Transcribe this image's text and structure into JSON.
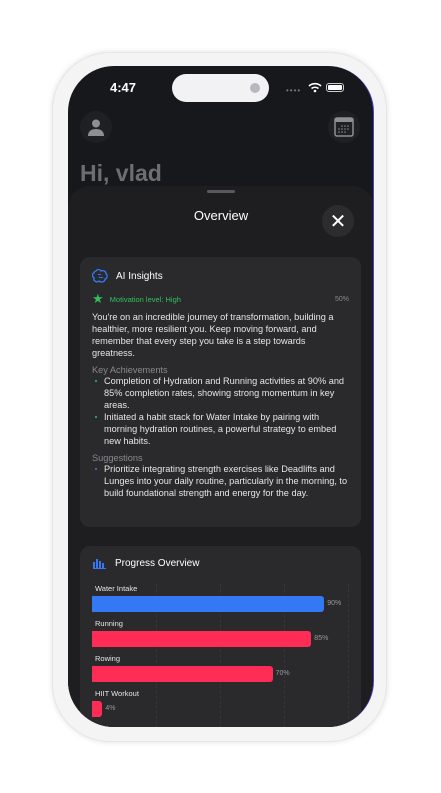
{
  "status": {
    "time": "4:47"
  },
  "header": {
    "greeting": "Hi, vlad"
  },
  "sheet": {
    "title": "Overview"
  },
  "ai_insights": {
    "title": "AI Insights",
    "motivation_label": "Motivation level: High",
    "motivation_percent": "50%",
    "message": "You're on an incredible journey of transformation, building a healthier, more resilient you. Keep moving forward, and remember that every step you take is a step towards greatness.",
    "achievements_heading": "Key Achievements",
    "achievements": [
      "Completion of Hydration and Running activities at 90% and 85% completion rates, showing strong momentum in key areas.",
      "Initiated a habit stack for Water Intake by pairing with morning hydration routines, a powerful strategy to embed new habits."
    ],
    "suggestions_heading": "Suggestions",
    "suggestions": [
      "Prioritize integrating strength exercises like Deadlifts and Lunges into your daily routine, particularly in the morning, to build foundational strength and energy for the day."
    ]
  },
  "progress": {
    "title": "Progress Overview",
    "items": [
      {
        "label": "Water Intake",
        "value": 90,
        "text": "90%",
        "color": "#3478f6"
      },
      {
        "label": "Running",
        "value": 85,
        "text": "85%",
        "color": "#ff2d55"
      },
      {
        "label": "Rowing",
        "value": 70,
        "text": "70%",
        "color": "#ff2d55"
      },
      {
        "label": "HIIT Workout",
        "value": 4,
        "text": "4%",
        "color": "#ff2d55"
      }
    ]
  }
}
